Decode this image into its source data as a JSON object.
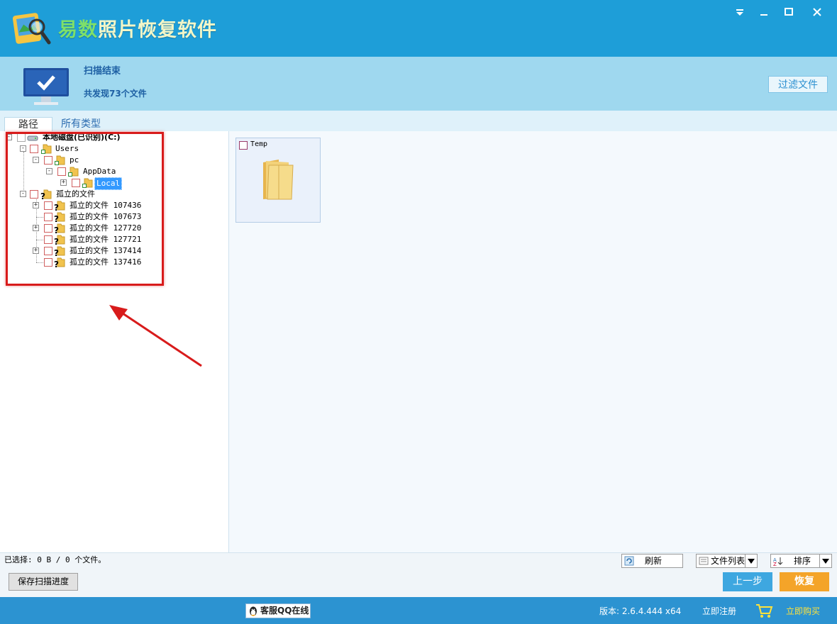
{
  "app": {
    "title_part1": "易数",
    "title_part2": "照片恢复软件"
  },
  "window_controls": {
    "menu_icon": "menu-down-icon",
    "minimize_icon": "minimize-icon",
    "maximize_icon": "maximize-icon",
    "close_icon": "close-icon"
  },
  "status": {
    "title": "扫描结束",
    "count_text": "共发现73个文件",
    "filter_button": "过滤文件"
  },
  "tabs": [
    {
      "label": "路径",
      "active": true
    },
    {
      "label": "所有类型",
      "active": false
    }
  ],
  "tree": {
    "root": "本地磁盘(已识别)(C:)",
    "users": "Users",
    "pc": "pc",
    "appdata": "AppData",
    "local": "Local",
    "orphan": "孤立的文件",
    "orphans": [
      "孤立的文件 107436",
      "孤立的文件 107673",
      "孤立的文件 127720",
      "孤立的文件 127721",
      "孤立的文件 137414",
      "孤立的文件 137416"
    ]
  },
  "files": [
    {
      "name": "Temp",
      "icon": "folder-icon"
    }
  ],
  "bottom": {
    "selection_info": "已选择: 0 B / 0 个文件。",
    "refresh": "刷新",
    "view": "文件列表",
    "sort": "排序",
    "save_progress": "保存扫描进度",
    "prev": "上一步",
    "recover": "恢复"
  },
  "footer": {
    "qq": "客服QQ在线",
    "version": "版本: 2.6.4.444 x64",
    "register": "立即注册",
    "buy": "立即购买"
  },
  "colors": {
    "titlebar": "#1e9ed8",
    "status_band": "#9fd8ef",
    "footer": "#2c93d1",
    "accent_orange": "#f4a429",
    "highlight_red": "#d81b1b"
  }
}
